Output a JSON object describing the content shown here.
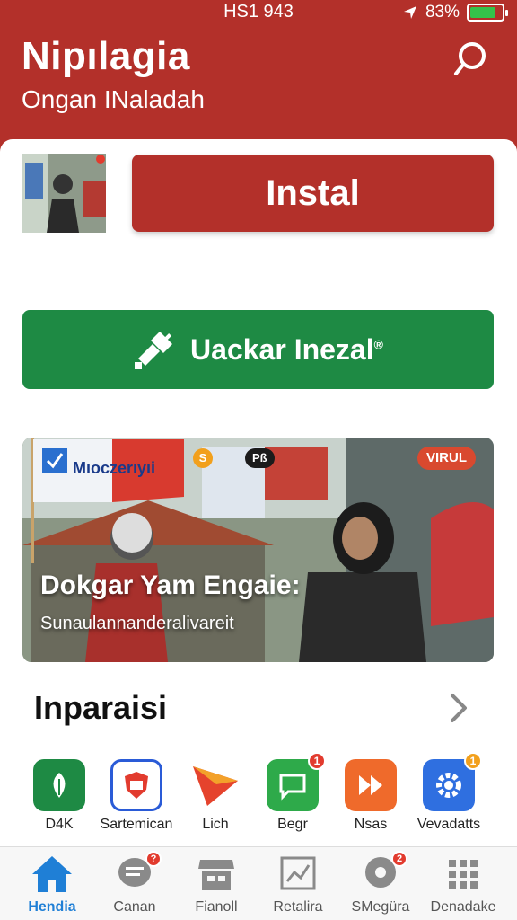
{
  "status": {
    "time": "HS1 943",
    "battery_percent": "83%",
    "battery_level": 0.83
  },
  "header": {
    "title": "Nipılagia",
    "subtitle": "Ongan INaladah"
  },
  "main": {
    "install_label": "Instal",
    "green_button_label": "Uackar Inezal",
    "green_button_mark": "®",
    "banner": {
      "title": "Dokgar Yam Engaie:",
      "subtitle": "Sunaulannanderalivareit",
      "flag_text": "Mıoczerıyıi",
      "badge_left": "S",
      "badge_mid": "Pß",
      "badge_right": "VIRUL"
    },
    "section_title": "Inparaisi",
    "apps": [
      {
        "label": "D4K",
        "icon": "leaf-icon",
        "color": "#1e8a44"
      },
      {
        "label": "Sartemican",
        "icon": "shield-icon",
        "color": "#2a5bd7"
      },
      {
        "label": "Lich",
        "icon": "play-triangle-icon",
        "color": "#e5432d"
      },
      {
        "label": "Begr",
        "icon": "chat-bubble-icon",
        "color": "#2eaa4a",
        "badge": "1"
      },
      {
        "label": "Nsas",
        "icon": "fast-forward-icon",
        "color": "#ef6a2b"
      },
      {
        "label": "Vevadatts",
        "icon": "gear-icon",
        "color": "#2f6fe0",
        "badge": "1"
      }
    ]
  },
  "tabs": [
    {
      "label": "Hendia",
      "icon": "home-icon",
      "active": true
    },
    {
      "label": "Canan",
      "icon": "chat-icon",
      "badge": "?"
    },
    {
      "label": "Fianoll",
      "icon": "store-icon"
    },
    {
      "label": "Retalira",
      "icon": "chart-icon"
    },
    {
      "label": "SMegüra",
      "icon": "music-icon",
      "badge": "2"
    },
    {
      "label": "Denadake",
      "icon": "grid-icon"
    }
  ],
  "colors": {
    "brand_red": "#b3302a",
    "brand_green": "#1e8a44",
    "active_blue": "#1f7fd6"
  }
}
